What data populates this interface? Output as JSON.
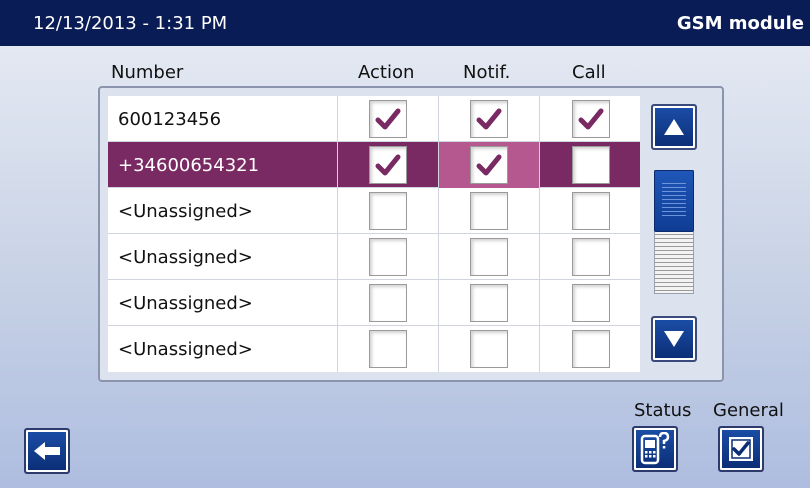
{
  "titlebar": {
    "datetime": "12/13/2013  -  1:31 PM",
    "module": "GSM module"
  },
  "columns": {
    "number": "Number",
    "action": "Action",
    "notif": "Notif.",
    "call": "Call"
  },
  "rows": [
    {
      "number": "600123456",
      "action": true,
      "notif": true,
      "call": true,
      "selected": false
    },
    {
      "number": "+34600654321",
      "action": true,
      "notif": true,
      "call": false,
      "selected": true
    },
    {
      "number": "<Unassigned>",
      "action": false,
      "notif": false,
      "call": false,
      "selected": false
    },
    {
      "number": "<Unassigned>",
      "action": false,
      "notif": false,
      "call": false,
      "selected": false
    },
    {
      "number": "<Unassigned>",
      "action": false,
      "notif": false,
      "call": false,
      "selected": false
    },
    {
      "number": "<Unassigned>",
      "action": false,
      "notif": false,
      "call": false,
      "selected": false
    }
  ],
  "buttons": {
    "status_label": "Status",
    "general_label": "General"
  },
  "icons": {
    "back": "left-arrow-icon",
    "scroll_up": "triangle-up-icon",
    "scroll_down": "triangle-down-icon",
    "status": "phone-question-icon",
    "general": "checkbox-check-icon",
    "check": "check-mark-icon"
  },
  "colors": {
    "titlebar": "#0a1c55",
    "selected_row": "#7a2a62",
    "selected_highlight": "#b5588f",
    "check": "#7a2a62",
    "button": "#0b2d75"
  }
}
